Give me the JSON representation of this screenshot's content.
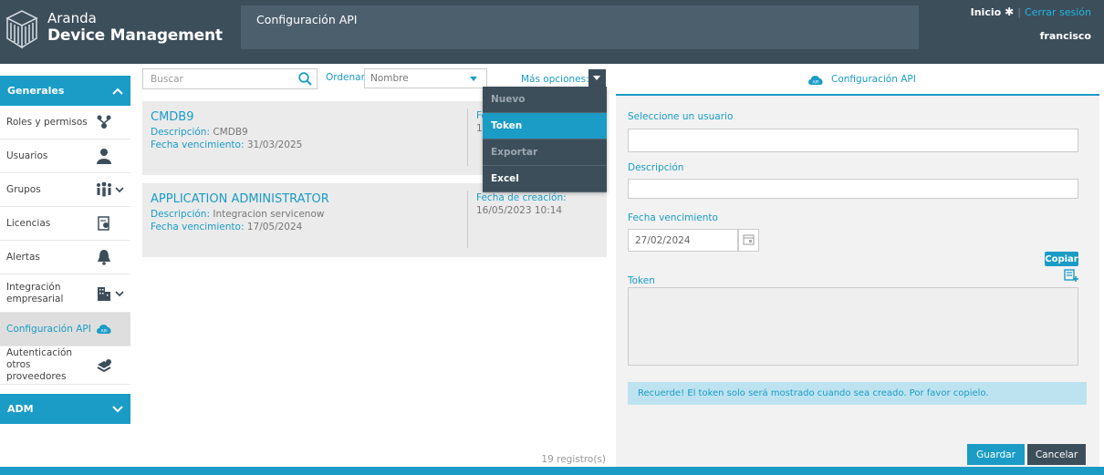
{
  "app": {
    "brand_line1": "Aranda",
    "brand_line2": "Device Management",
    "page_title": "Configuración API"
  },
  "topnav": {
    "home_label": "Inicio",
    "logout_label": "Cerrar sesión",
    "separator": "|",
    "username": "francisco"
  },
  "sidebar": {
    "section_general": "Generales",
    "items": [
      {
        "label": "Roles y permisos",
        "icon": "roles-icon"
      },
      {
        "label": "Usuarios",
        "icon": "user-icon"
      },
      {
        "label": "Grupos",
        "icon": "group-icon"
      },
      {
        "label": "Licencias",
        "icon": "license-icon"
      },
      {
        "label": "Alertas",
        "icon": "bell-icon"
      },
      {
        "label": "Integración empresarial",
        "icon": "building-icon"
      },
      {
        "label": "Configuración API",
        "icon": "api-cloud-icon"
      },
      {
        "label": "Autenticación otros proveedores",
        "icon": "auth-providers-icon"
      }
    ],
    "section_adm": "ADM"
  },
  "list": {
    "search_placeholder": "Buscar",
    "order_label": "Ordenar:",
    "order_value": "Nombre",
    "more_options_label": "Más opciones:",
    "records_count": "19 registro(s)",
    "cards": [
      {
        "title": "CMDB9",
        "description_key": "Descripción:",
        "description_value": "CMDB9",
        "expiry_key": "Fecha vencimiento:",
        "expiry_value": "31/03/2025",
        "created_key": "Fe",
        "created_value": "1("
      },
      {
        "title": "APPLICATION ADMINISTRATOR",
        "description_key": "Descripción:",
        "description_value": "Integracion servicenow",
        "expiry_key": "Fecha vencimiento:",
        "expiry_value": "17/05/2024",
        "created_key": "Fecha de creación:",
        "created_value": "16/05/2023 10:14"
      }
    ]
  },
  "menu": {
    "items": [
      {
        "label": "Nuevo",
        "state": "disabled"
      },
      {
        "label": "Token",
        "state": "highlighted"
      },
      {
        "label": "Exportar",
        "state": "disabled"
      },
      {
        "label": "Excel",
        "state": "enabled"
      }
    ]
  },
  "form": {
    "tab_label": "Configuración API",
    "tab_icon_text": "API",
    "user_label": "Seleccione un usuario",
    "user_value": "",
    "description_label": "Descripción",
    "description_value": "",
    "expiry_label": "Fecha vencimiento",
    "expiry_value": "27/02/2024",
    "copy_label": "Copiar",
    "token_label": "Token",
    "token_value": "",
    "notice": "Recuerde! El token solo será mostrado cuando sea creado. Por favor copielo.",
    "save_label": "Guardar",
    "cancel_label": "Cancelar"
  },
  "colors": {
    "accent": "#1a9cc6",
    "header": "#3d4e5b",
    "header_title_box": "#4c5f6c",
    "notice_bg": "#bde3f0"
  }
}
